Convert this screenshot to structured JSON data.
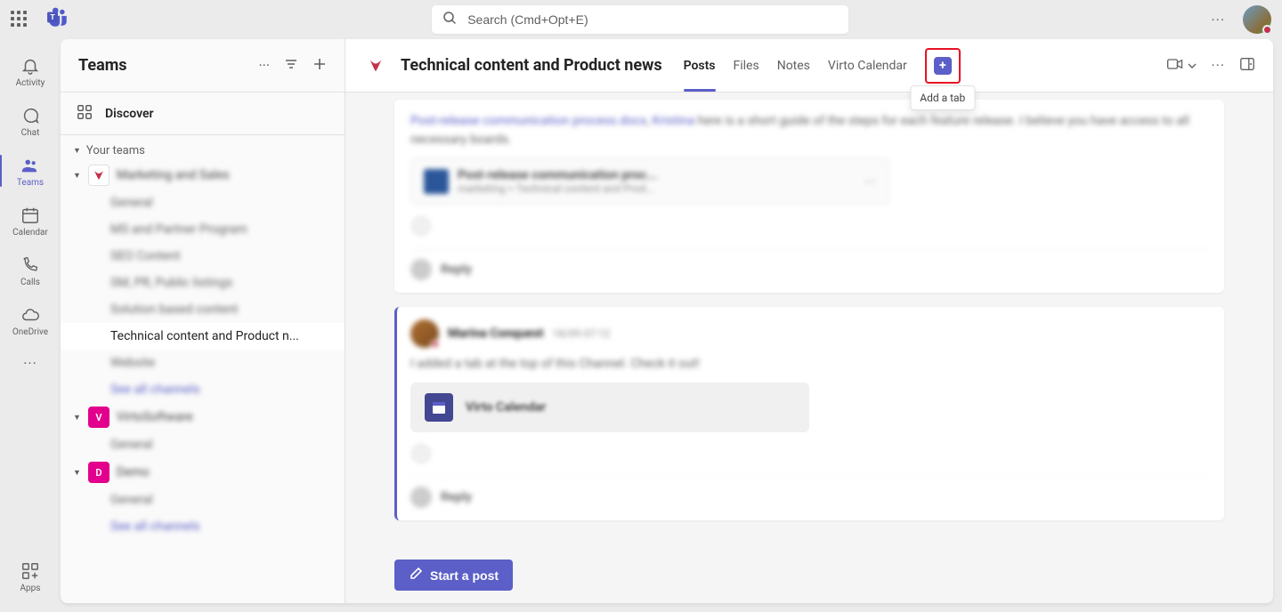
{
  "top": {
    "search_placeholder": "Search (Cmd+Opt+E)"
  },
  "rail": {
    "activity": "Activity",
    "chat": "Chat",
    "teams": "Teams",
    "calendar": "Calendar",
    "calls": "Calls",
    "onedrive": "OneDrive",
    "apps": "Apps"
  },
  "sidebar": {
    "title": "Teams",
    "discover": "Discover",
    "your_teams": "Your teams",
    "team1": "Marketing and Sales",
    "team1_channels": {
      "c0": "General",
      "c1": "MS and Partner Program",
      "c2": "SEO Content",
      "c3": "SM, PR, Public listings",
      "c4": "Solution based content",
      "c5": "Technical content and Product n...",
      "c6": "Website",
      "c7": "See all channels"
    },
    "team2": "VirtoSoftware",
    "team2_avatar": "V",
    "team2_channels": {
      "c0": "General"
    },
    "team3": "Demo",
    "team3_avatar": "D",
    "team3_channels": {
      "c0": "General",
      "c1": "See all channels"
    }
  },
  "channel": {
    "title": "Technical content and Product news",
    "tabs": {
      "posts": "Posts",
      "files": "Files",
      "notes": "Notes",
      "virto": "Virto Calendar"
    },
    "add_tab_tooltip": "Add a tab"
  },
  "posts": {
    "post1_link1": "Post-release communication process.docx",
    "post1_link2": "Kristina",
    "post1_text_a": " here is a short guide of the steps for each feature release. I believe you have access to all necessary boards.",
    "post1_file": "Post-release communication proc...",
    "post1_file_sub": "marketing > Technical content and Prod...",
    "reply": "Reply",
    "post2_user": "Marina Conquest",
    "post2_time": "18/09 07:12",
    "post2_text": "I added a tab at the top of this Channel. Check it out!",
    "post2_card": "Virto Calendar"
  },
  "compose": {
    "start": "Start a post"
  }
}
